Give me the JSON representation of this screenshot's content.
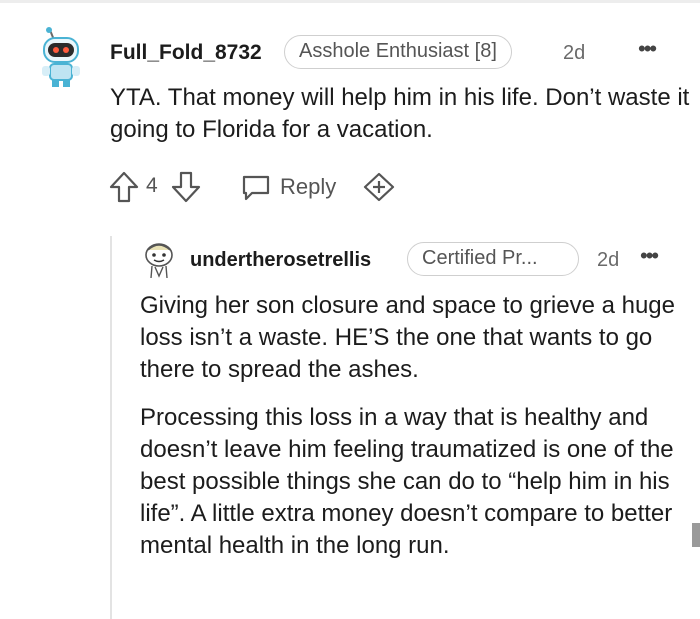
{
  "comment": {
    "username": "Full_Fold_8732",
    "flair": "Asshole Enthusiast [8]",
    "time": "2d",
    "more": "•••",
    "body": "YTA. That money will help him in his life. Don’t waste it going to Florida for a vacation.",
    "score": "4",
    "reply_label": "Reply",
    "icons": [
      "upvote-icon",
      "downvote-icon",
      "comment-bubble-icon",
      "award-icon",
      "more-options-icon"
    ]
  },
  "reply": {
    "username": "undertherosetrellis",
    "flair": "Certified Pr...",
    "time": "2d",
    "more": "•••",
    "paragraphs": [
      "Giving her son closure and space to grieve a huge loss isn’t a waste. HE’S the one that wants to go there to spread the ashes.",
      "Processing this loss in a way that is healthy and doesn’t leave him feeling traumatized is one of the best possible things she can do to “help him in his life”. A little extra money doesn’t compare to better mental health in the long run."
    ]
  },
  "colors": {
    "text": "#1c1c1c",
    "muted": "#555555",
    "border": "#cfcfcf",
    "avatar_accent": "#4ab3d4"
  }
}
